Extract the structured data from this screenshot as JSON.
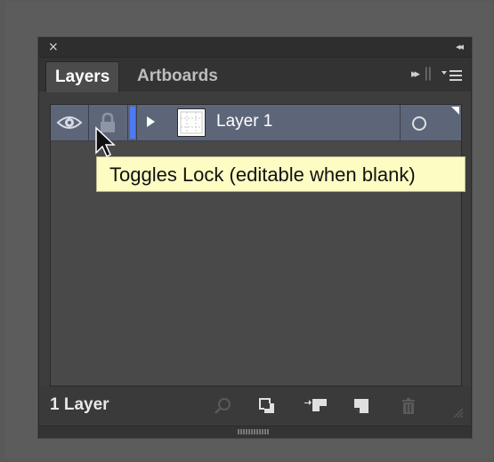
{
  "panel": {
    "close_glyph": "×",
    "collapse_glyph": "◂◂"
  },
  "tabs": [
    {
      "label": "Layers",
      "active": true
    },
    {
      "label": "Artboards",
      "active": false
    }
  ],
  "tab_controls": {
    "forward_glyph": "▸▸",
    "separator_glyph": "||"
  },
  "layers": [
    {
      "name": "Layer 1",
      "color": "#4f7af5",
      "visible": true,
      "locked": false,
      "selected": true
    }
  ],
  "tooltip": {
    "text": "Toggles Lock (editable when blank)"
  },
  "footer": {
    "count_label": "1 Layer"
  },
  "icons": {
    "eye": "eye-icon",
    "lock": "lock-icon",
    "expand": "expand-triangle-icon",
    "target": "target-circle-icon",
    "search": "locate-object-icon",
    "clipping_mask": "clipping-mask-icon",
    "new_sublayer": "new-sublayer-icon",
    "new_layer": "new-layer-icon",
    "trash": "trash-icon"
  },
  "colors": {
    "row_selected": "#5d6679",
    "layer_color": "#4f7af5",
    "tooltip_bg": "#fdfdc3"
  }
}
